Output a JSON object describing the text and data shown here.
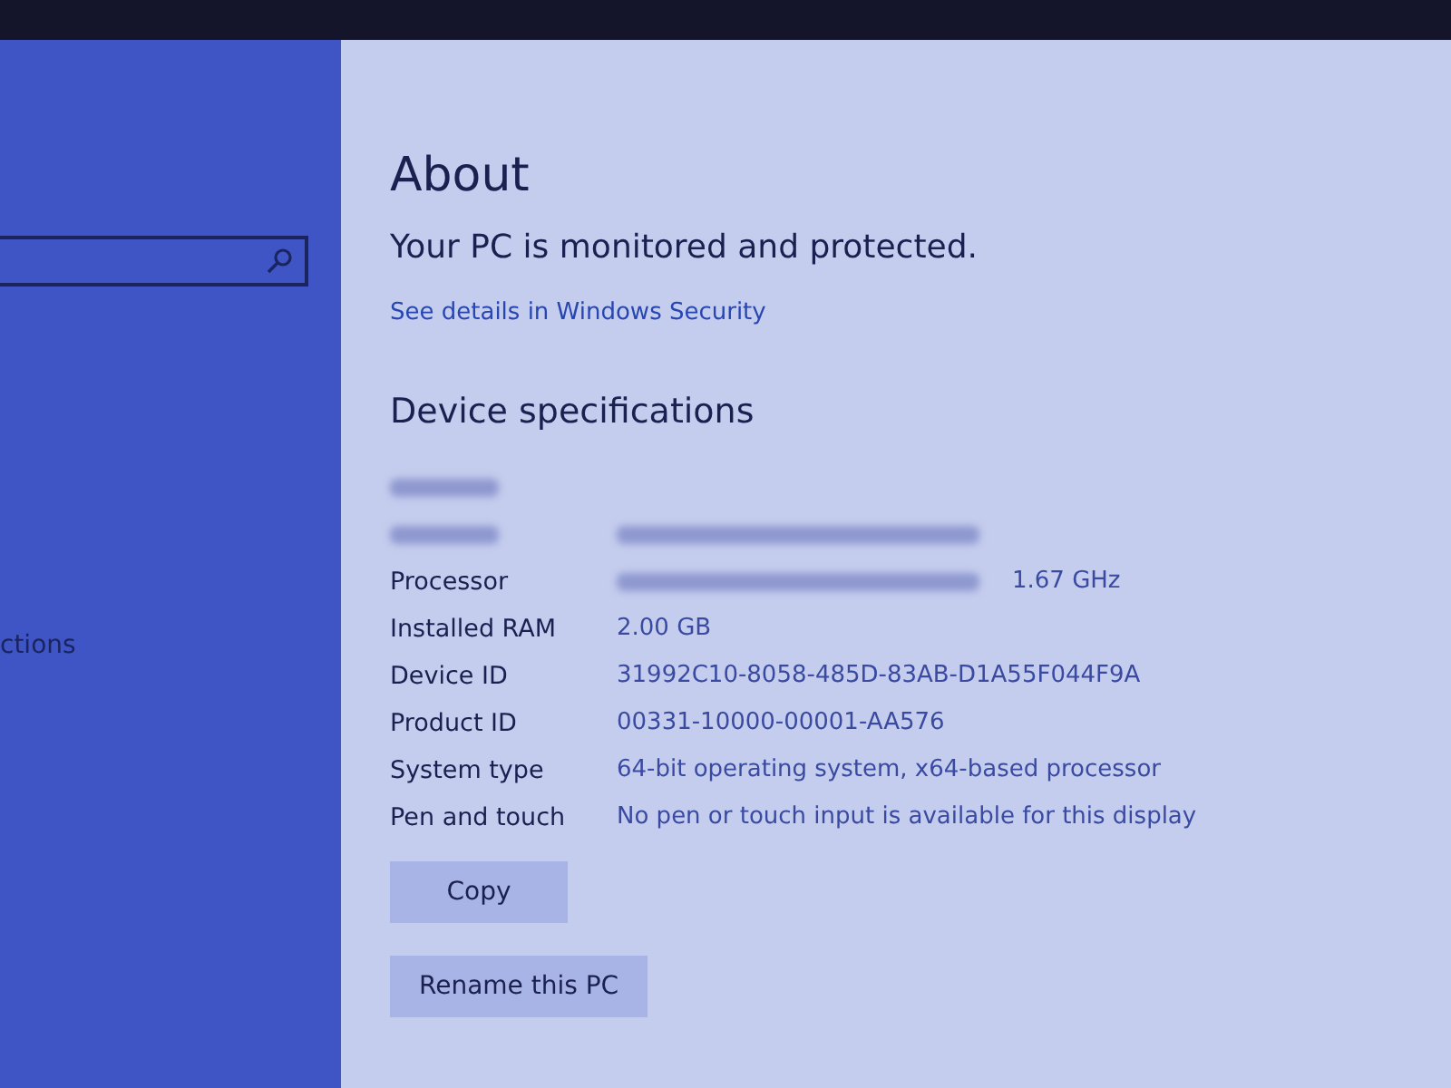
{
  "sidebar": {
    "items": [
      {
        "label": "ctions",
        "selected": false
      }
    ]
  },
  "page": {
    "title": "About",
    "status": "Your PC is monitored and protected.",
    "link": "See details in Windows Security",
    "section": "Device specifications"
  },
  "specs": [
    {
      "kind": "blurred"
    },
    {
      "kind": "blurred"
    },
    {
      "kind": "partial",
      "label": "Processor",
      "value": "1.67 GHz"
    },
    {
      "kind": "row",
      "label": "Installed RAM",
      "value": "2.00 GB"
    },
    {
      "kind": "row",
      "label": "Device ID",
      "value": "31992C10-8058-485D-83AB-D1A55F044F9A"
    },
    {
      "kind": "row",
      "label": "Product ID",
      "value": "00331-10000-00001-AA576"
    },
    {
      "kind": "row",
      "label": "System type",
      "value": "64-bit operating system, x64-based processor"
    },
    {
      "kind": "row",
      "label": "Pen and touch",
      "value": "No pen or touch input is available for this display"
    }
  ],
  "buttons": [
    "Copy",
    "Rename this PC"
  ]
}
